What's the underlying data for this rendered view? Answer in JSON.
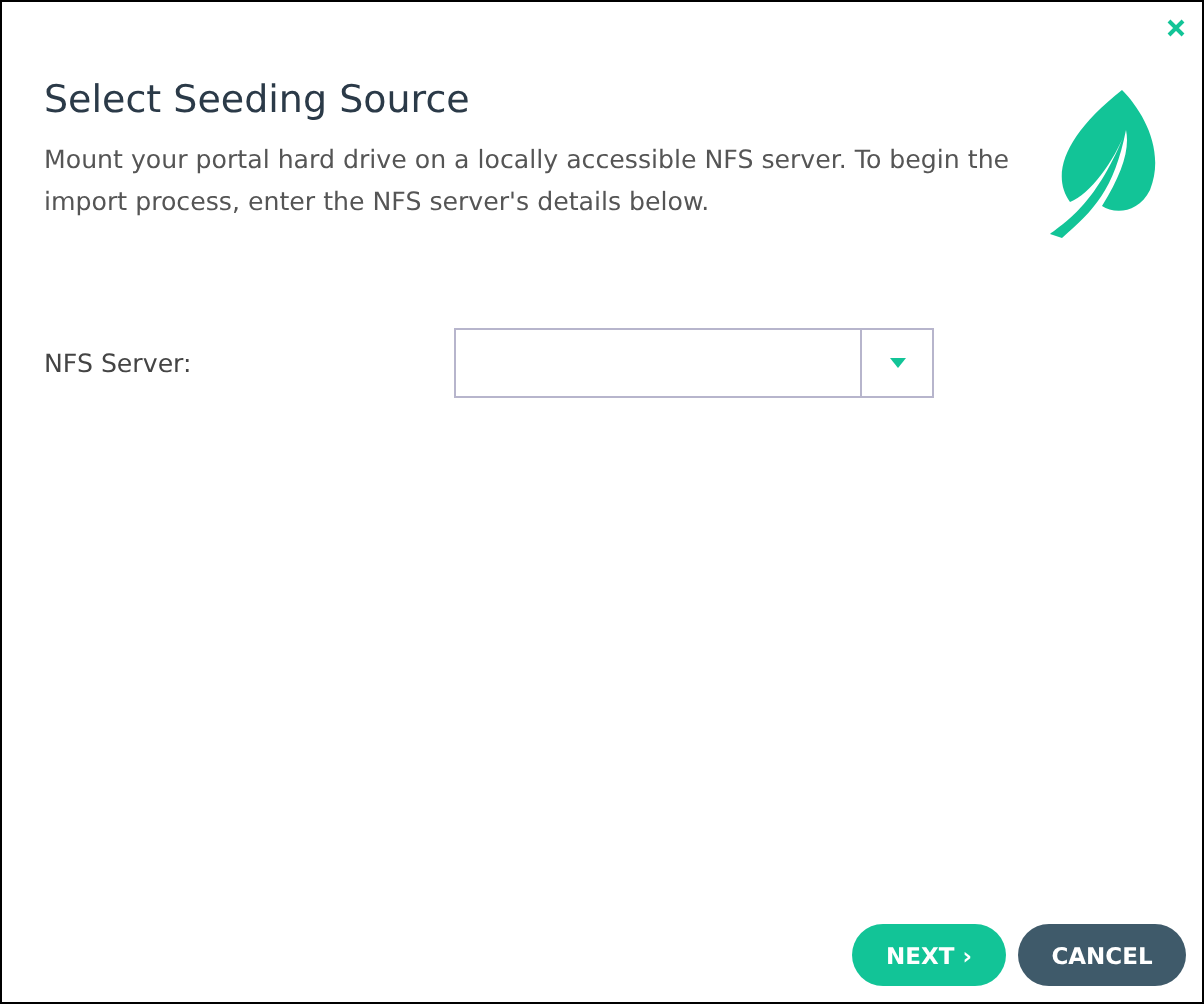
{
  "dialog": {
    "title": "Select Seeding Source",
    "description": "Mount your portal hard drive on a locally accessible NFS server. To begin the import process, enter the NFS server's details below."
  },
  "fields": [
    {
      "label": "NFS Server:",
      "kind": "dropdown"
    }
  ],
  "buttons": [
    {
      "label": "NEXT ›",
      "kind": "primary"
    },
    {
      "label": "CANCEL",
      "kind": "secondary"
    }
  ]
}
